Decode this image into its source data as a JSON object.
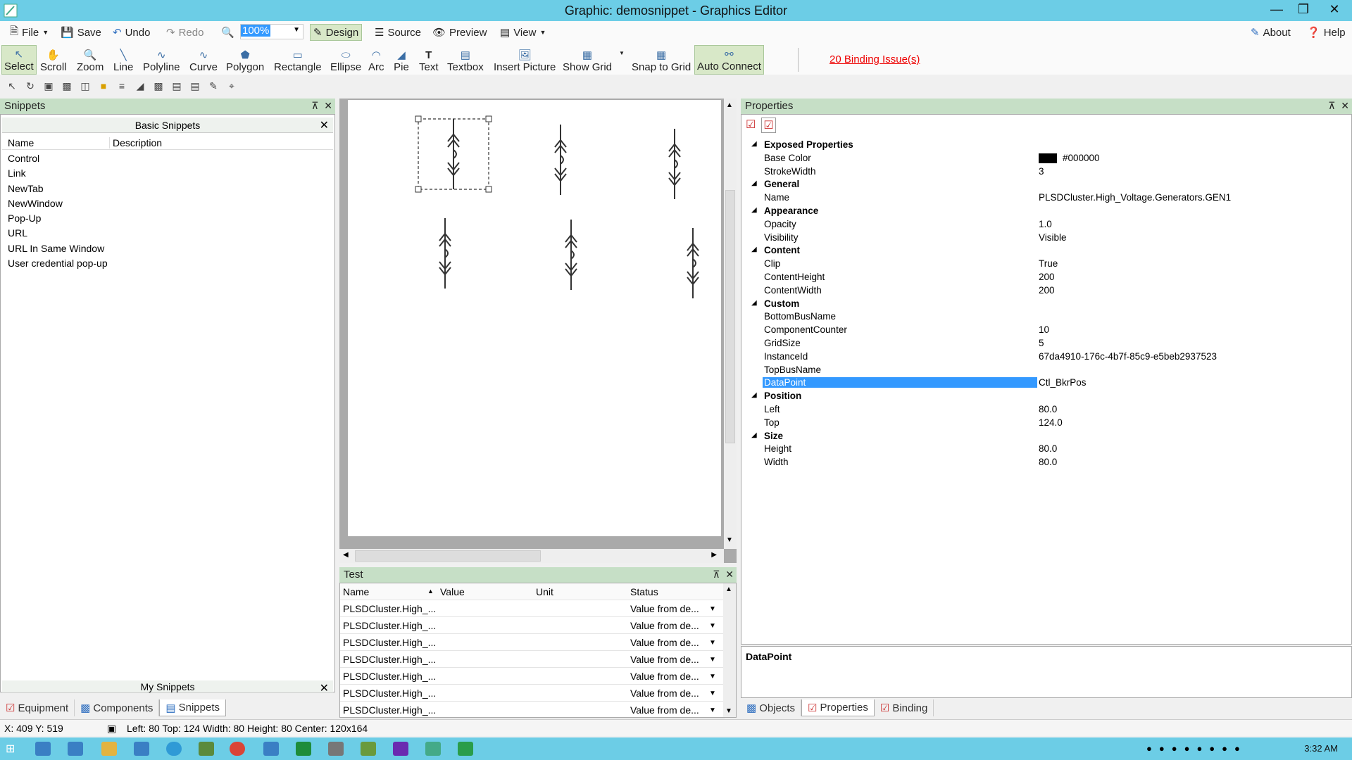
{
  "window": {
    "title": "Graphic: demosnippet - Graphics Editor"
  },
  "menu": {
    "file": "File",
    "save": "Save",
    "undo": "Undo",
    "redo": "Redo",
    "zoom": "100%",
    "design": "Design",
    "source": "Source",
    "preview": "Preview",
    "view": "View",
    "about": "About",
    "help": "Help"
  },
  "tools": [
    {
      "label": "Select",
      "icon": "select-arrow-icon"
    },
    {
      "label": "Scroll",
      "icon": "hand-icon"
    },
    {
      "label": "Zoom",
      "icon": "magnifier-icon"
    },
    {
      "label": "Line",
      "icon": "line-icon"
    },
    {
      "label": "Polyline",
      "icon": "polyline-icon"
    },
    {
      "label": "Curve",
      "icon": "curve-icon"
    },
    {
      "label": "Polygon",
      "icon": "polygon-icon"
    },
    {
      "label": "Rectangle",
      "icon": "rectangle-icon"
    },
    {
      "label": "Ellipse",
      "icon": "ellipse-icon"
    },
    {
      "label": "Arc",
      "icon": "arc-icon"
    },
    {
      "label": "Pie",
      "icon": "pie-icon"
    },
    {
      "label": "Text",
      "icon": "text-icon"
    },
    {
      "label": "Textbox",
      "icon": "textbox-icon"
    },
    {
      "label": "Insert Picture",
      "icon": "picture-icon"
    },
    {
      "label": "Show Grid",
      "icon": "grid-icon"
    },
    {
      "label": "Snap to Grid",
      "icon": "snap-icon"
    },
    {
      "label": "Auto Connect",
      "icon": "connect-icon"
    }
  ],
  "binding_issues": "20 Binding Issue(s)",
  "snippets": {
    "title": "Snippets",
    "basic_title": "Basic Snippets",
    "col_name": "Name",
    "col_description": "Description",
    "items": [
      "Control",
      "Link",
      "NewTab",
      "NewWindow",
      "Pop-Up",
      "URL",
      "URL In Same Window",
      "User credential pop-up"
    ],
    "my_title": "My Snippets",
    "tabs": [
      "Equipment",
      "Components",
      "Snippets"
    ]
  },
  "test": {
    "title": "Test",
    "headers": [
      "Name",
      "Value",
      "Unit",
      "Status"
    ],
    "rows": [
      {
        "name": "PLSDCluster.High_...",
        "value": "",
        "unit": "",
        "status": "Value from de..."
      },
      {
        "name": "PLSDCluster.High_...",
        "value": "",
        "unit": "",
        "status": "Value from de..."
      },
      {
        "name": "PLSDCluster.High_...",
        "value": "",
        "unit": "",
        "status": "Value from de..."
      },
      {
        "name": "PLSDCluster.High_...",
        "value": "",
        "unit": "",
        "status": "Value from de..."
      },
      {
        "name": "PLSDCluster.High_...",
        "value": "",
        "unit": "",
        "status": "Value from de..."
      },
      {
        "name": "PLSDCluster.High_...",
        "value": "",
        "unit": "",
        "status": "Value from de..."
      },
      {
        "name": "PLSDCluster.High_...",
        "value": "",
        "unit": "",
        "status": "Value from de..."
      }
    ]
  },
  "properties": {
    "title": "Properties",
    "rows": [
      {
        "cat": true,
        "k": "Exposed Properties"
      },
      {
        "k": "Base Color",
        "v": "#000000",
        "swatch": "#000000"
      },
      {
        "k": "StrokeWidth",
        "v": "3"
      },
      {
        "cat": true,
        "k": "General"
      },
      {
        "k": "Name",
        "v": "PLSDCluster.High_Voltage.Generators.GEN1"
      },
      {
        "cat": true,
        "k": "Appearance"
      },
      {
        "k": "Opacity",
        "v": "1.0"
      },
      {
        "k": "Visibility",
        "v": "Visible"
      },
      {
        "cat": true,
        "k": "Content"
      },
      {
        "k": "Clip",
        "v": "True"
      },
      {
        "k": "ContentHeight",
        "v": "200"
      },
      {
        "k": "ContentWidth",
        "v": "200"
      },
      {
        "cat": true,
        "k": "Custom"
      },
      {
        "k": "BottomBusName",
        "v": ""
      },
      {
        "k": "ComponentCounter",
        "v": "10"
      },
      {
        "k": "GridSize",
        "v": "5"
      },
      {
        "k": "InstanceId",
        "v": "67da4910-176c-4b7f-85c9-e5beb2937523"
      },
      {
        "k": "TopBusName",
        "v": ""
      },
      {
        "k": "DataPoint",
        "v": "Ctl_BkrPos",
        "selected": true
      },
      {
        "cat": true,
        "k": "Position"
      },
      {
        "k": "Left",
        "v": "80.0"
      },
      {
        "k": "Top",
        "v": "124.0"
      },
      {
        "cat": true,
        "k": "Size"
      },
      {
        "k": "Height",
        "v": "80.0"
      },
      {
        "k": "Width",
        "v": "80.0"
      }
    ],
    "description": "DataPoint",
    "tabs": [
      "Objects",
      "Properties",
      "Binding"
    ]
  },
  "status": {
    "cursor": "X: 409  Y: 519",
    "geometry": "Left: 80  Top: 124  Width: 80  Height: 80  Center: 120x164"
  },
  "taskbar": {
    "clock": "3:32 AM"
  }
}
